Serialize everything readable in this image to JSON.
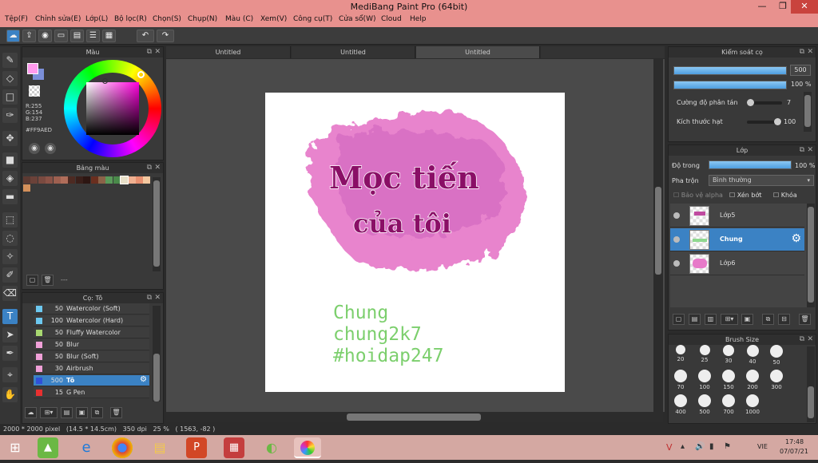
{
  "app": {
    "title": "MediBang Paint Pro (64bit)",
    "min": "—",
    "max": "❐",
    "close": "✕"
  },
  "menu": [
    "Tệp(F)",
    "Chỉnh sửa(E)",
    "Lớp(L)",
    "Bộ lọc(R)",
    "Chọn(S)",
    "Chụp(N)",
    "Màu (C)",
    "Xem(V)",
    "Công cụ(T)",
    "Cửa sổ(W)",
    "Cloud",
    "Help"
  ],
  "tabs": [
    "Untitled",
    "Untitled",
    "Untitled"
  ],
  "color_panel": {
    "title": "Màu",
    "r": "R:255",
    "g": "G:154",
    "b": "B:237",
    "hex": "#FF9AED",
    "main_color": "#ff9aed",
    "sub_color": "#7b8fd9"
  },
  "palette_panel": {
    "title": "Bảng màu",
    "more": "---",
    "colors": [
      "#5c3a32",
      "#6b4239",
      "#7a4a40",
      "#8b5347",
      "#9e6050",
      "#b06d5a",
      "#4d2a22",
      "#3a1f1a",
      "#2d1612",
      "#6a2f1f",
      "#8b6248",
      "#5a9a5a",
      "#4a8a4a",
      "#e8e0c8",
      "#f0b090",
      "#e89070",
      "#f4c8a0",
      "#d4905a"
    ]
  },
  "brush_panel": {
    "title": "Cọ: Tô",
    "brushes": [
      {
        "size": "50",
        "name": "Watercolor (Soft)",
        "color": "#6cc8f0"
      },
      {
        "size": "100",
        "name": "Watercolor (Hard)",
        "color": "#6cc8f0"
      },
      {
        "size": "50",
        "name": "Fluffy Watercolor",
        "color": "#a8d870"
      },
      {
        "size": "50",
        "name": "Blur",
        "color": "#f0a0d8"
      },
      {
        "size": "50",
        "name": "Blur (Soft)",
        "color": "#f0a0d8"
      },
      {
        "size": "30",
        "name": "Airbrush",
        "color": "#f0a0d8"
      },
      {
        "size": "500",
        "name": "Tô",
        "color": "#3050d8"
      },
      {
        "size": "15",
        "name": "G Pen",
        "color": "#e83030"
      }
    ]
  },
  "brush_control": {
    "title": "Kiểm soát cọ",
    "size_value": "500",
    "opacity_value": "100 %",
    "scatter_label": "Cường độ phân tán",
    "scatter_value": "7",
    "particle_label": "Kích thước hạt",
    "particle_value": "100"
  },
  "layer_panel": {
    "title": "Lớp",
    "opacity_label": "Độ trong",
    "opacity_value": "100 %",
    "blend_label": "Pha trộn",
    "blend_value": "Bình thường",
    "protect_alpha": "Bảo vệ alpha",
    "clipping": "Xén bớt",
    "lock": "Khóa",
    "layers": [
      {
        "name": "Lớp5",
        "selected": false
      },
      {
        "name": "Chung",
        "selected": true
      },
      {
        "name": "Lớp6",
        "selected": false
      }
    ]
  },
  "brush_size_panel": {
    "title": "Brush Size",
    "sizes": [
      "20",
      "25",
      "30",
      "40",
      "50",
      "70",
      "100",
      "150",
      "200",
      "300",
      "400",
      "500",
      "700",
      "1000"
    ]
  },
  "artwork": {
    "line1": "Mọc tiến",
    "line2": "của tôi",
    "text1": "Chung",
    "text2": "chung2k7",
    "text3": "#hoidap247"
  },
  "status": "2000 * 2000 pixel   (14.5 * 14.5cm)   350 dpi   25 %   ( 1563, -82 )",
  "taskbar": {
    "time": "17:48",
    "date": "07/07/21",
    "lang": "VIE"
  }
}
